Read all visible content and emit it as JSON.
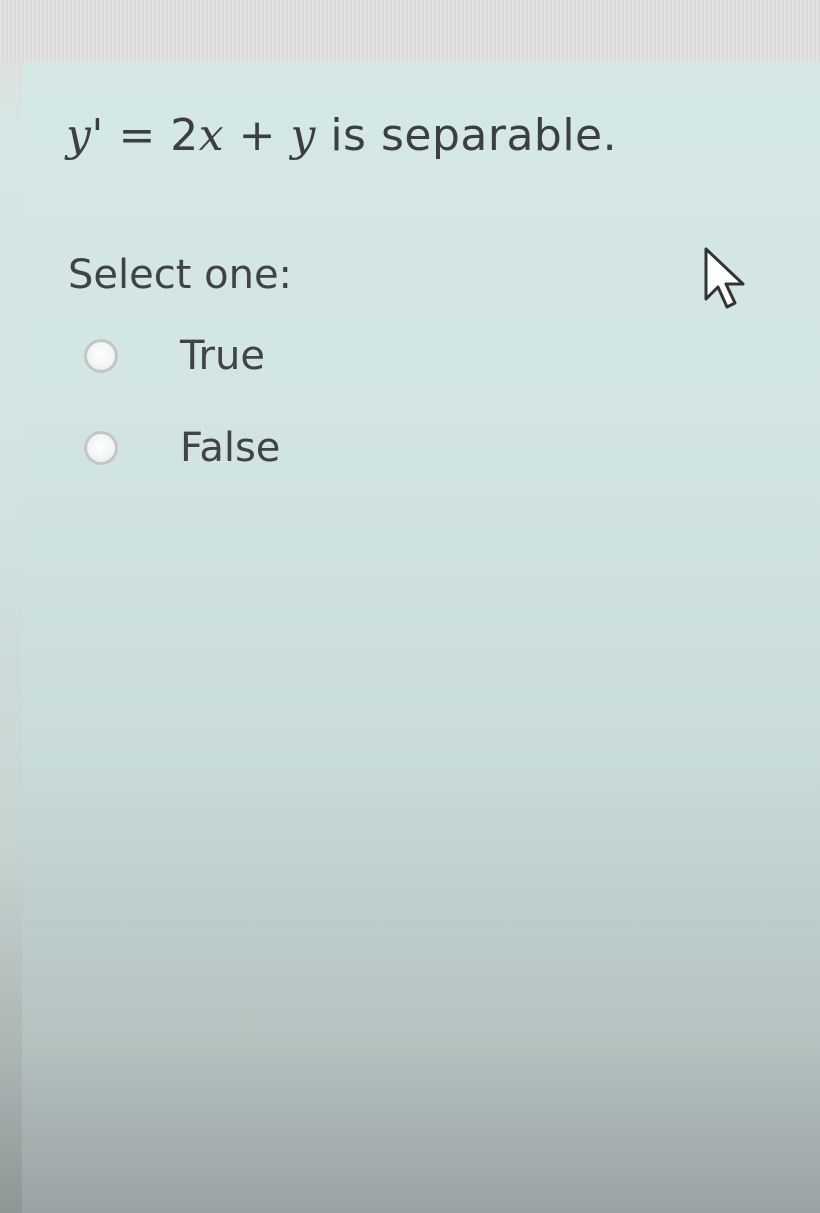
{
  "question": {
    "lhs": "y'",
    "equals": " = ",
    "num": "2",
    "x": "x",
    "plus": " + ",
    "y": "y",
    "rest": "is separable."
  },
  "prompt": "Select one:",
  "options": [
    {
      "label": "True",
      "selected": false
    },
    {
      "label": "False",
      "selected": false
    }
  ],
  "icons": {
    "radio": "radio-circle-icon",
    "cursor": "mouse-pointer-icon"
  },
  "colors": {
    "panel_bg": "#d2e5e3",
    "text": "#3b3f40"
  }
}
